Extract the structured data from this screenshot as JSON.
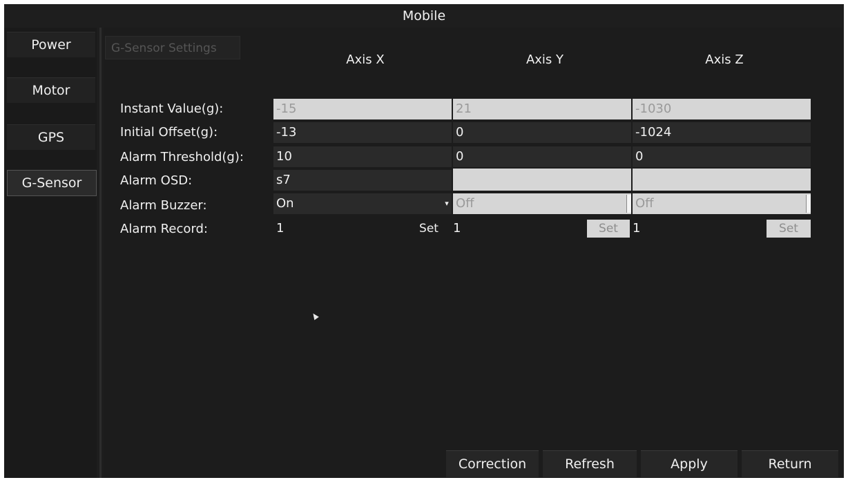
{
  "window": {
    "title": "Mobile"
  },
  "sidebar": {
    "items": [
      {
        "label": "Power",
        "active": false
      },
      {
        "label": "Motor",
        "active": false
      },
      {
        "label": "GPS",
        "active": false
      },
      {
        "label": "G-Sensor",
        "active": true
      }
    ]
  },
  "section": {
    "title": "G-Sensor Settings"
  },
  "columns": [
    "Axis X",
    "Axis Y",
    "Axis Z"
  ],
  "rows": {
    "instant_value": {
      "label": "Instant Value(g):",
      "values": [
        "-15",
        "21",
        "-1030"
      ],
      "editable": false
    },
    "initial_offset": {
      "label": "Initial Offset(g):",
      "values": [
        "-13",
        "0",
        "-1024"
      ],
      "editable": true
    },
    "alarm_threshold": {
      "label": "Alarm Threshold(g):",
      "values": [
        "10",
        "0",
        "0"
      ],
      "editable": true
    },
    "alarm_osd": {
      "label": "Alarm OSD:",
      "values": [
        "s7",
        "",
        ""
      ],
      "editable": [
        true,
        false,
        false
      ]
    },
    "alarm_buzzer": {
      "label": "Alarm Buzzer:",
      "values": [
        "On",
        "Off",
        "Off"
      ],
      "editable": [
        true,
        false,
        false
      ]
    },
    "alarm_record": {
      "label": "Alarm Record:",
      "values": [
        "1",
        "1",
        "1"
      ],
      "set_label": "Set"
    }
  },
  "footer": {
    "correction_label": "Correction",
    "refresh_label": "Refresh",
    "apply_label": "Apply",
    "return_label": "Return"
  },
  "icons": {
    "dropdown": "caret-down-icon",
    "cursor": "mouse-pointer-icon"
  },
  "colors": {
    "background": "#1e1e1e",
    "field_dark": "#2a2a2a",
    "field_disabled": "#d6d6d6",
    "text": "#f0f0f0"
  }
}
